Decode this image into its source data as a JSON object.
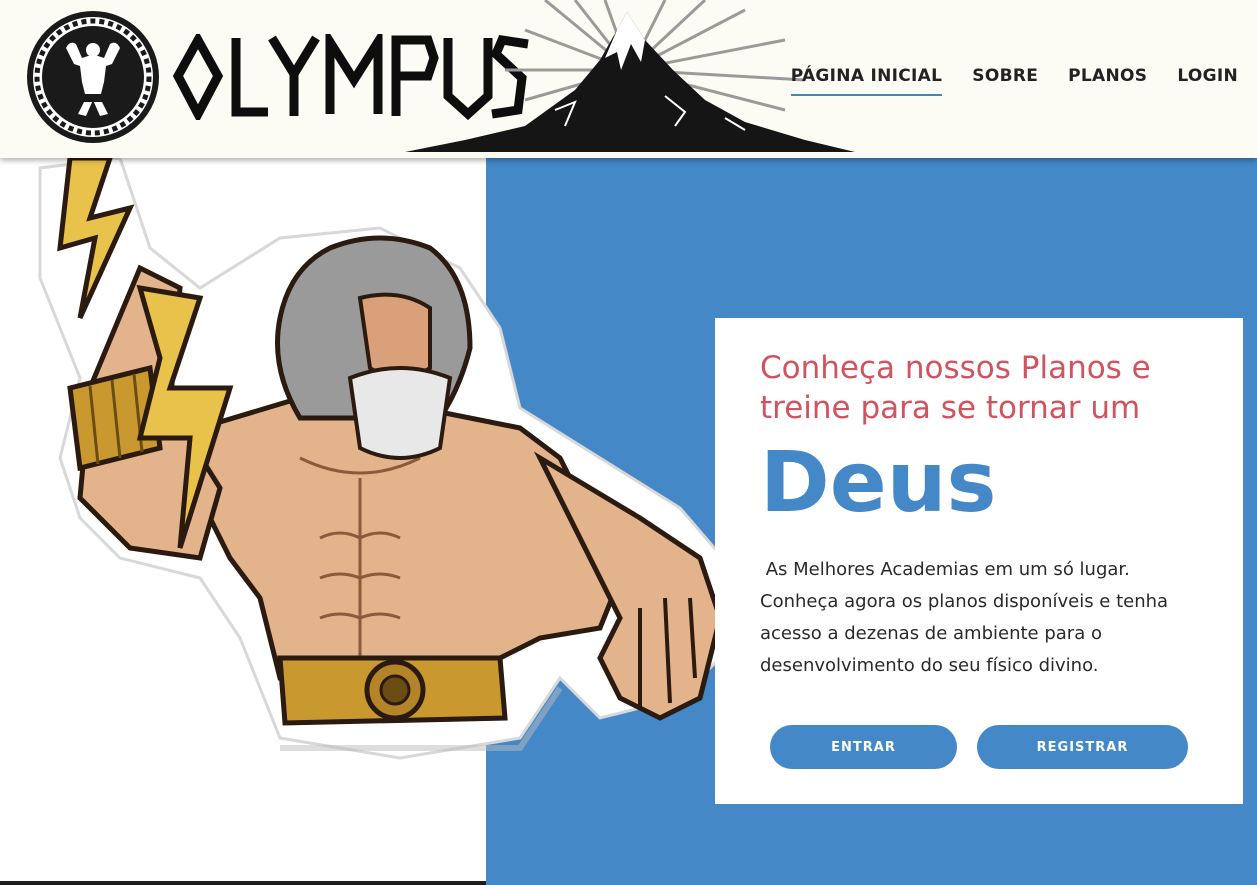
{
  "header": {
    "logo_text": "OLYMPUS",
    "emblem": "bodybuilder-emblem-icon",
    "mountain": "mountain-icon"
  },
  "nav": {
    "items": [
      {
        "label": "PÁGINA INICIAL",
        "active": true
      },
      {
        "label": "SOBRE",
        "active": false
      },
      {
        "label": "PLANOS",
        "active": false
      },
      {
        "label": "LOGIN",
        "active": false
      }
    ]
  },
  "hero": {
    "illustration": "zeus-illustration",
    "heading": "Conheça nossos Planos e treine para se tornar um",
    "title": "Deus",
    "description": " As Melhores Academias em um só lugar. Conheça agora os planos disponíveis e tenha acesso a dezenas de ambiente para o desenvolvimento do seu físico divino.",
    "buttons": {
      "entrar": "ENTRAR",
      "registrar": "REGISTRAR"
    }
  },
  "colors": {
    "accent_blue": "#4488c8",
    "heading_red": "#d0545f",
    "header_bg": "#fcfcf4"
  }
}
